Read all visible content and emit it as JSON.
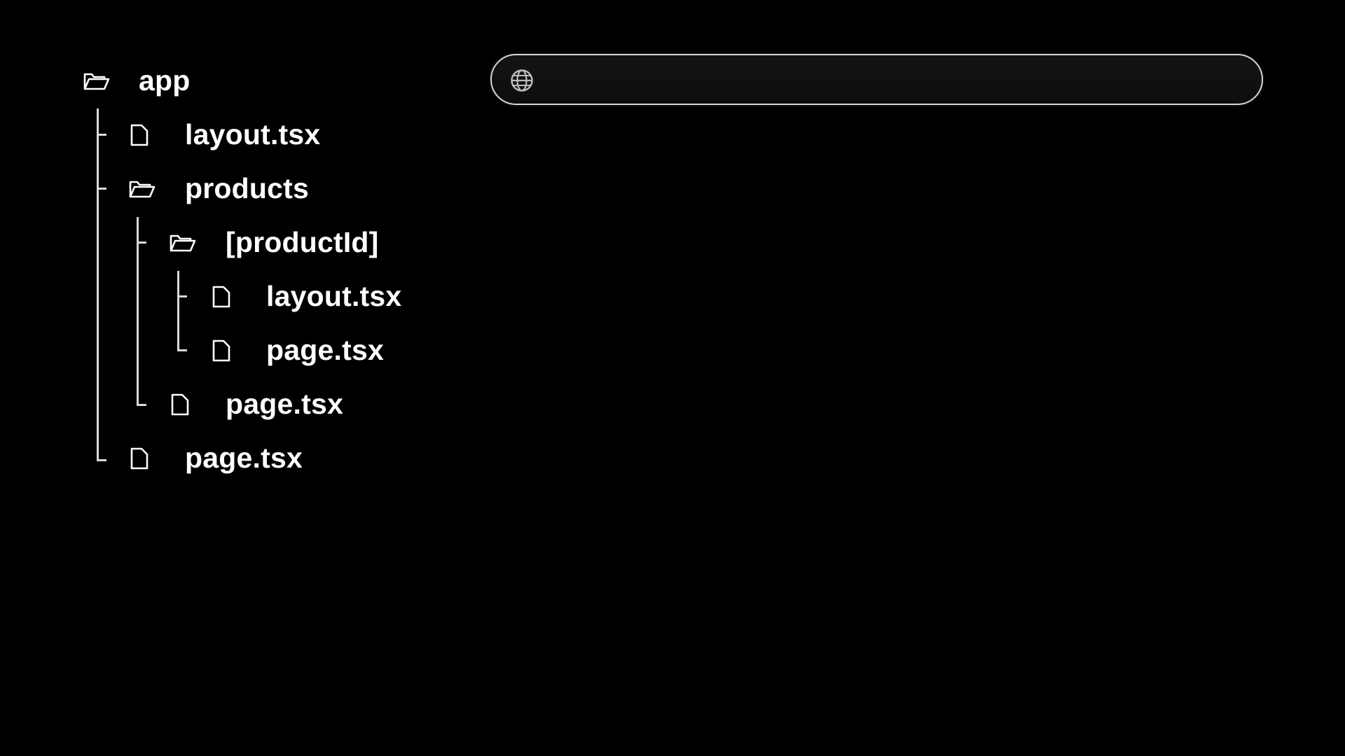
{
  "file_tree": {
    "root": {
      "label": "app",
      "icon": "folder-open-icon"
    },
    "items": [
      {
        "label": "layout.tsx",
        "icon": "file-icon"
      },
      {
        "label": "products",
        "icon": "folder-open-icon"
      },
      {
        "label": "[productId]",
        "icon": "folder-open-icon"
      },
      {
        "label": "layout.tsx",
        "icon": "file-icon"
      },
      {
        "label": "page.tsx",
        "icon": "file-icon"
      },
      {
        "label": "page.tsx",
        "icon": "file-icon"
      },
      {
        "label": "page.tsx",
        "icon": "file-icon"
      }
    ]
  },
  "address_bar": {
    "icon": "globe-icon",
    "url": ""
  },
  "colors": {
    "background": "#000000",
    "text": "#ffffff",
    "tree_lines": "#d9d9d9",
    "address_bar_border": "#d6d6d6"
  }
}
